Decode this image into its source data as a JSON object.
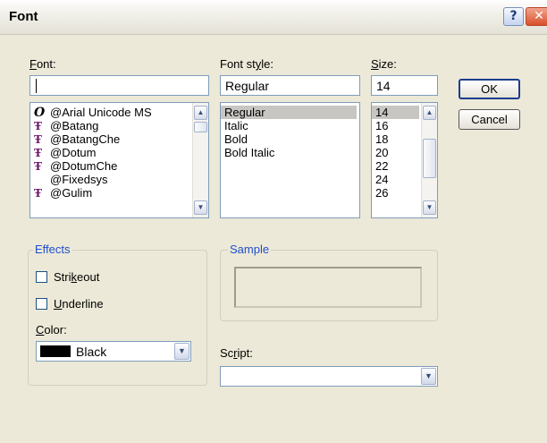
{
  "window": {
    "title": "Font",
    "help_glyph": "?",
    "close_glyph": "✕"
  },
  "font": {
    "label_prefix": "",
    "label_accel": "F",
    "label_rest": "ont:",
    "input_value": "",
    "items": [
      {
        "name": "@Arial Unicode MS",
        "icon": "opentype-icon",
        "glyph": "O"
      },
      {
        "name": "@Batang",
        "icon": "truetype-icon",
        "glyph": "Ŧ"
      },
      {
        "name": "@BatangChe",
        "icon": "truetype-icon",
        "glyph": "Ŧ"
      },
      {
        "name": "@Dotum",
        "icon": "truetype-icon",
        "glyph": "Ŧ"
      },
      {
        "name": "@DotumChe",
        "icon": "truetype-icon",
        "glyph": "Ŧ"
      },
      {
        "name": "@Fixedsys",
        "icon": "",
        "glyph": ""
      },
      {
        "name": "@Gulim",
        "icon": "truetype-icon",
        "glyph": "Ŧ"
      }
    ]
  },
  "style": {
    "label_prefix": "Font st",
    "label_accel": "y",
    "label_rest": "le:",
    "input_value": "Regular",
    "items": [
      "Regular",
      "Italic",
      "Bold",
      "Bold Italic"
    ],
    "selected": "Regular"
  },
  "size": {
    "label_prefix": "",
    "label_accel": "S",
    "label_rest": "ize:",
    "input_value": "14",
    "items": [
      "14",
      "16",
      "18",
      "20",
      "22",
      "24",
      "26"
    ],
    "selected": "14"
  },
  "buttons": {
    "ok": "OK",
    "cancel": "Cancel"
  },
  "effects": {
    "title": "Effects",
    "strikeout_prefix": "Stri",
    "strikeout_accel": "k",
    "strikeout_rest": "eout",
    "underline_prefix": "",
    "underline_accel": "U",
    "underline_rest": "nderline",
    "color_prefix": "",
    "color_accel": "C",
    "color_rest": "olor:",
    "color_value": "Black",
    "color_swatch": "#000000"
  },
  "sample": {
    "title": "Sample"
  },
  "script": {
    "label_prefix": "Sc",
    "label_accel": "r",
    "label_rest": "ipt:",
    "value": ""
  },
  "colors": {
    "group_title": "#1f4fcc",
    "field_border": "#7f9db9",
    "dialog_bg": "#ece9d8"
  }
}
